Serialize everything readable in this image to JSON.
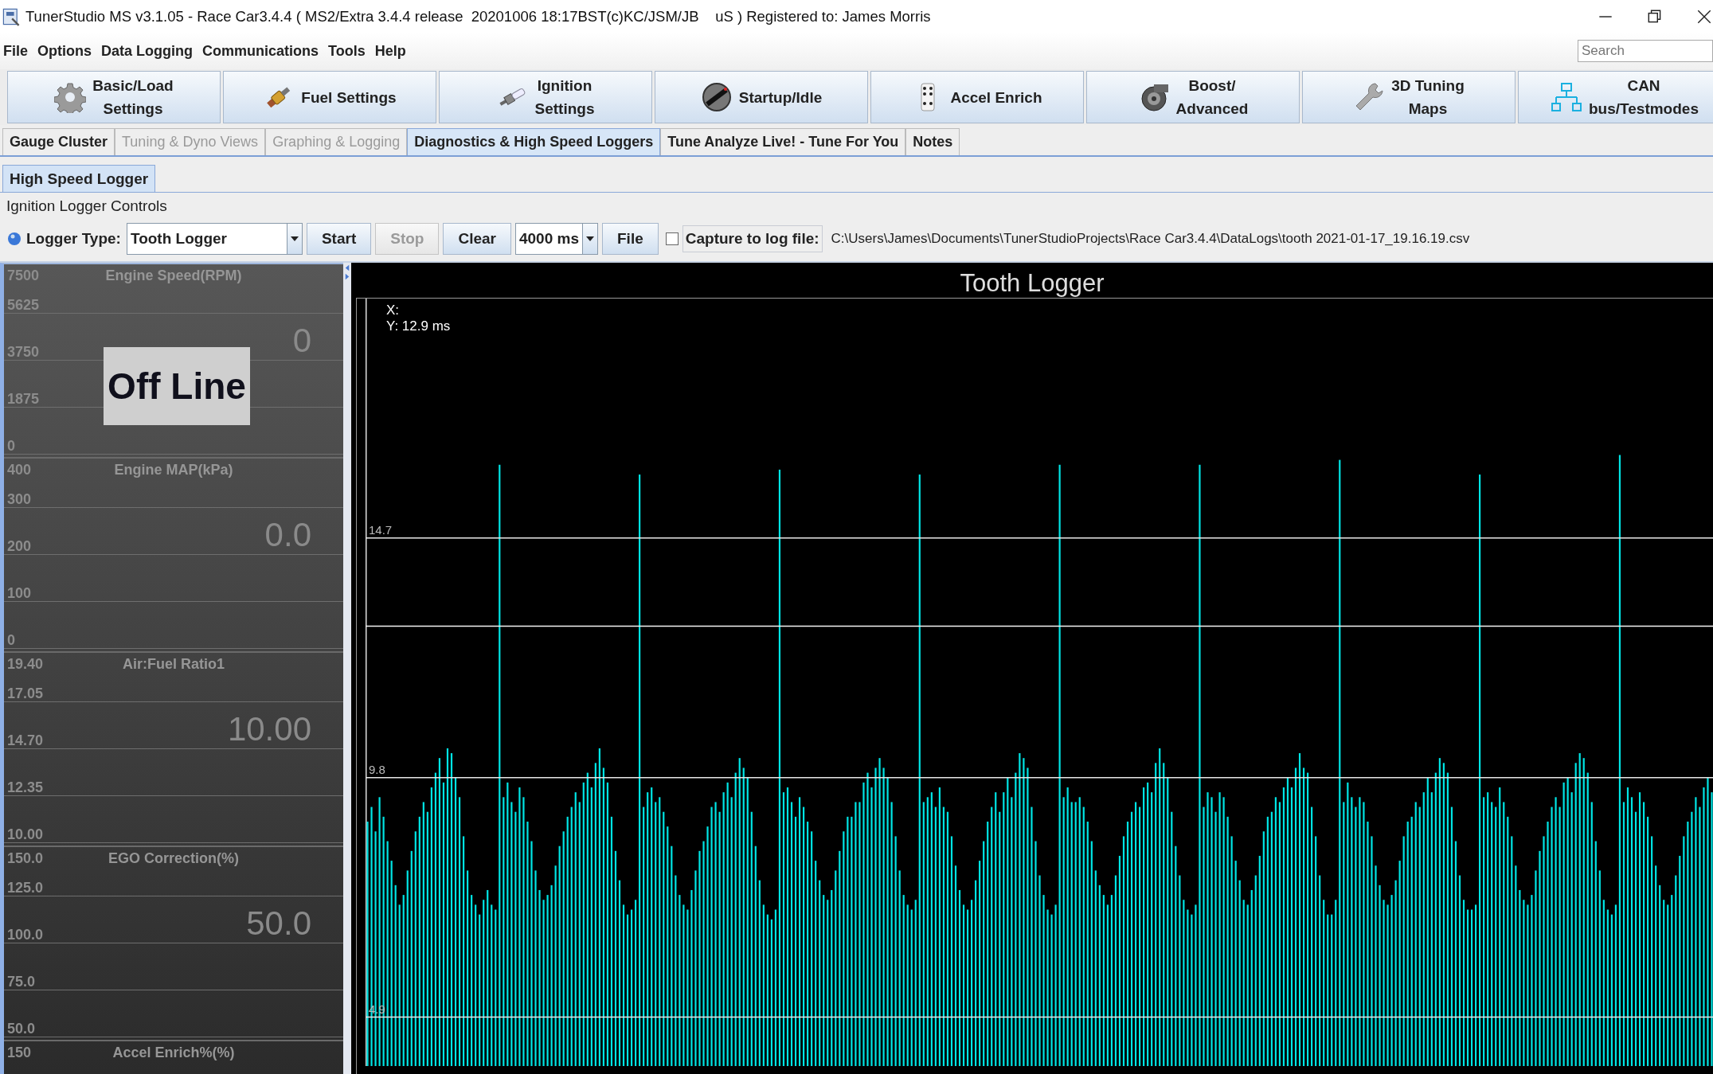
{
  "window": {
    "title": "TunerStudio MS v3.1.05 - Race Car3.4.4 ( MS2/Extra 3.4.4 release  20201006 18:17BST(c)KC/JSM/JB    uS ) Registered to: James Morris"
  },
  "menu": [
    "File",
    "Options",
    "Data Logging",
    "Communications",
    "Tools",
    "Help"
  ],
  "search": {
    "placeholder": "Search"
  },
  "toolbar": [
    {
      "lines": [
        "Basic/Load",
        "Settings"
      ]
    },
    {
      "lines": [
        "Fuel Settings"
      ]
    },
    {
      "lines": [
        "Ignition",
        "Settings"
      ]
    },
    {
      "lines": [
        "Startup/Idle"
      ]
    },
    {
      "lines": [
        "Accel Enrich"
      ]
    },
    {
      "lines": [
        "Boost/",
        "Advanced"
      ]
    },
    {
      "lines": [
        "3D Tuning",
        "Maps"
      ]
    },
    {
      "lines": [
        "CAN",
        "bus/Testmodes"
      ]
    }
  ],
  "tabs": [
    {
      "label": "Gauge Cluster",
      "selected": false,
      "disabled": false
    },
    {
      "label": "Tuning & Dyno Views",
      "selected": false,
      "disabled": true
    },
    {
      "label": "Graphing & Logging",
      "selected": false,
      "disabled": true
    },
    {
      "label": "Diagnostics & High Speed Loggers",
      "selected": true,
      "disabled": false
    },
    {
      "label": "Tune Analyze Live! - Tune For You",
      "selected": false,
      "disabled": false
    },
    {
      "label": "Notes",
      "selected": false,
      "disabled": false
    }
  ],
  "subtabs": [
    {
      "label": "High Speed Logger",
      "selected": true
    }
  ],
  "logger_controls": {
    "title": "Ignition Logger Controls",
    "logger_type_label": "Logger Type:",
    "logger_type": "Tooth Logger",
    "buttons": [
      {
        "label": "Start",
        "disabled": false
      },
      {
        "label": "Stop",
        "disabled": true
      },
      {
        "label": "Clear",
        "disabled": false
      }
    ],
    "duration": "4000 ms",
    "file_button": "File",
    "capture": {
      "label": "Capture to log file:",
      "checked": false
    },
    "log_path": "C:\\Users\\James\\Documents\\TunerStudioProjects\\Race Car3.4.4\\DataLogs\\tooth 2021-01-17_19.16.19.csv"
  },
  "gauges": [
    {
      "title": "Engine Speed(RPM)",
      "scale": [
        "7500",
        "5625",
        "3750",
        "1875",
        "0"
      ],
      "value": "0",
      "overlay": "Off Line"
    },
    {
      "title": "Engine MAP(kPa)",
      "scale": [
        "400",
        "300",
        "200",
        "100",
        "0"
      ],
      "value": "0.0"
    },
    {
      "title": "Air:Fuel Ratio1",
      "scale": [
        "19.40",
        "17.05",
        "14.70",
        "12.35",
        "10.00"
      ],
      "value": "10.00"
    },
    {
      "title": "EGO Correction(%)",
      "scale": [
        "150.0",
        "125.0",
        "100.0",
        "75.0",
        "50.0"
      ],
      "value": "50.0"
    },
    {
      "title": "Accel Enrich%(%)",
      "scale": [
        "150"
      ]
    }
  ],
  "chart": {
    "title": "Tooth Logger",
    "cursor": {
      "x": "X:"
    },
    "chart_data": {
      "type": "bar",
      "ylim": [
        3.9,
        19.6
      ],
      "yticks": [
        4.9,
        9.8,
        14.7
      ],
      "grid": true,
      "ref_lines": [
        {
          "axis": "y",
          "value": 12.9,
          "label": "Y: 12.9 ms"
        }
      ],
      "values": [
        8.9,
        9.2,
        8.7,
        9.4,
        9.0,
        8.5,
        8.1,
        7.6,
        7.2,
        7.4,
        7.9,
        8.3,
        8.7,
        9.0,
        9.3,
        9.1,
        9.6,
        9.9,
        10.2,
        9.7,
        10.4,
        10.3,
        9.8,
        9.4,
        8.6,
        7.9,
        7.4,
        7.2,
        7.0,
        7.3,
        7.5,
        7.2,
        7.1,
        16.2,
        9.4,
        9.7,
        9.3,
        9.1,
        9.6,
        9.4,
        8.9,
        8.5,
        7.9,
        7.5,
        7.3,
        7.4,
        7.6,
        8.0,
        8.4,
        8.7,
        9.0,
        9.2,
        9.5,
        9.3,
        9.7,
        9.9,
        9.6,
        10.1,
        10.4,
        10.0,
        9.7,
        9.0,
        8.3,
        7.7,
        7.2,
        7.0,
        7.1,
        7.3,
        16.0,
        9.2,
        9.5,
        9.6,
        9.3,
        9.4,
        9.1,
        8.8,
        8.4,
        7.8,
        7.4,
        7.2,
        7.1,
        7.5,
        7.9,
        8.3,
        8.5,
        8.8,
        9.2,
        9.3,
        9.1,
        9.5,
        9.7,
        9.4,
        9.9,
        10.2,
        10.0,
        9.8,
        9.1,
        8.4,
        7.7,
        7.2,
        7.0,
        6.9,
        7.1,
        16.1,
        9.5,
        9.6,
        9.3,
        9.0,
        9.4,
        9.2,
        8.9,
        8.7,
        8.1,
        7.7,
        7.4,
        7.3,
        7.5,
        7.9,
        8.3,
        8.7,
        9.0,
        9.0,
        9.3,
        9.3,
        9.7,
        9.9,
        9.6,
        10.0,
        10.2,
        10.0,
        9.8,
        9.3,
        8.6,
        7.9,
        7.4,
        7.2,
        7.1,
        7.3,
        16.0,
        9.3,
        9.4,
        9.5,
        9.2,
        9.6,
        9.2,
        9.1,
        8.6,
        8.0,
        7.5,
        7.2,
        7.1,
        7.3,
        7.7,
        8.1,
        8.5,
        8.9,
        9.2,
        9.5,
        9.1,
        9.5,
        9.8,
        9.4,
        9.9,
        10.3,
        10.2,
        10.0,
        9.2,
        8.5,
        7.8,
        7.4,
        7.1,
        7.0,
        7.2,
        16.2,
        9.4,
        9.6,
        9.3,
        9.3,
        9.4,
        9.2,
        8.9,
        8.5,
        7.9,
        7.6,
        7.4,
        7.2,
        7.4,
        7.8,
        8.2,
        8.6,
        8.9,
        9.1,
        9.3,
        9.2,
        9.6,
        9.7,
        9.5,
        10.1,
        10.4,
        10.1,
        9.8,
        9.1,
        8.4,
        7.8,
        7.3,
        7.1,
        7.0,
        7.2,
        16.2,
        9.2,
        9.5,
        9.4,
        9.1,
        9.5,
        9.4,
        9.0,
        8.6,
        8.1,
        7.7,
        7.3,
        7.2,
        7.5,
        7.8,
        8.2,
        8.7,
        9.0,
        9.1,
        9.4,
        9.3,
        9.6,
        9.8,
        9.6,
        10.0,
        10.3,
        10.0,
        9.9,
        9.2,
        8.6,
        7.8,
        7.3,
        7.0,
        7.0,
        7.3,
        16.3,
        9.3,
        9.7,
        9.4,
        9.2,
        9.4,
        9.3,
        8.9,
        8.6,
        8.0,
        7.6,
        7.3,
        7.2,
        7.4,
        7.7,
        8.1,
        8.6,
        8.9,
        9.0,
        9.3,
        9.2,
        9.5,
        9.8,
        9.5,
        9.9,
        10.2,
        10.1,
        9.9,
        9.2,
        8.5,
        7.8,
        7.3,
        7.1,
        7.1,
        7.2,
        16.0,
        9.4,
        9.5,
        9.3,
        9.2,
        9.6,
        9.3,
        9.0,
        8.6,
        8.0,
        7.5,
        7.3,
        7.2,
        7.4,
        7.9,
        8.3,
        8.6,
        8.9,
        9.2,
        9.4,
        9.2,
        9.7,
        9.8,
        9.5,
        10.1,
        10.3,
        10.2,
        9.9,
        9.3,
        8.5,
        7.9,
        7.3,
        7.1,
        7.0,
        7.2,
        16.4,
        9.3,
        9.6,
        9.4,
        9.1,
        9.5,
        9.3,
        9.0,
        8.6,
        8.0,
        7.6,
        7.3,
        7.2,
        7.4,
        7.8,
        8.2,
        8.6,
        8.9,
        9.1,
        9.4,
        9.2,
        9.6,
        9.8,
        9.5
      ]
    }
  }
}
